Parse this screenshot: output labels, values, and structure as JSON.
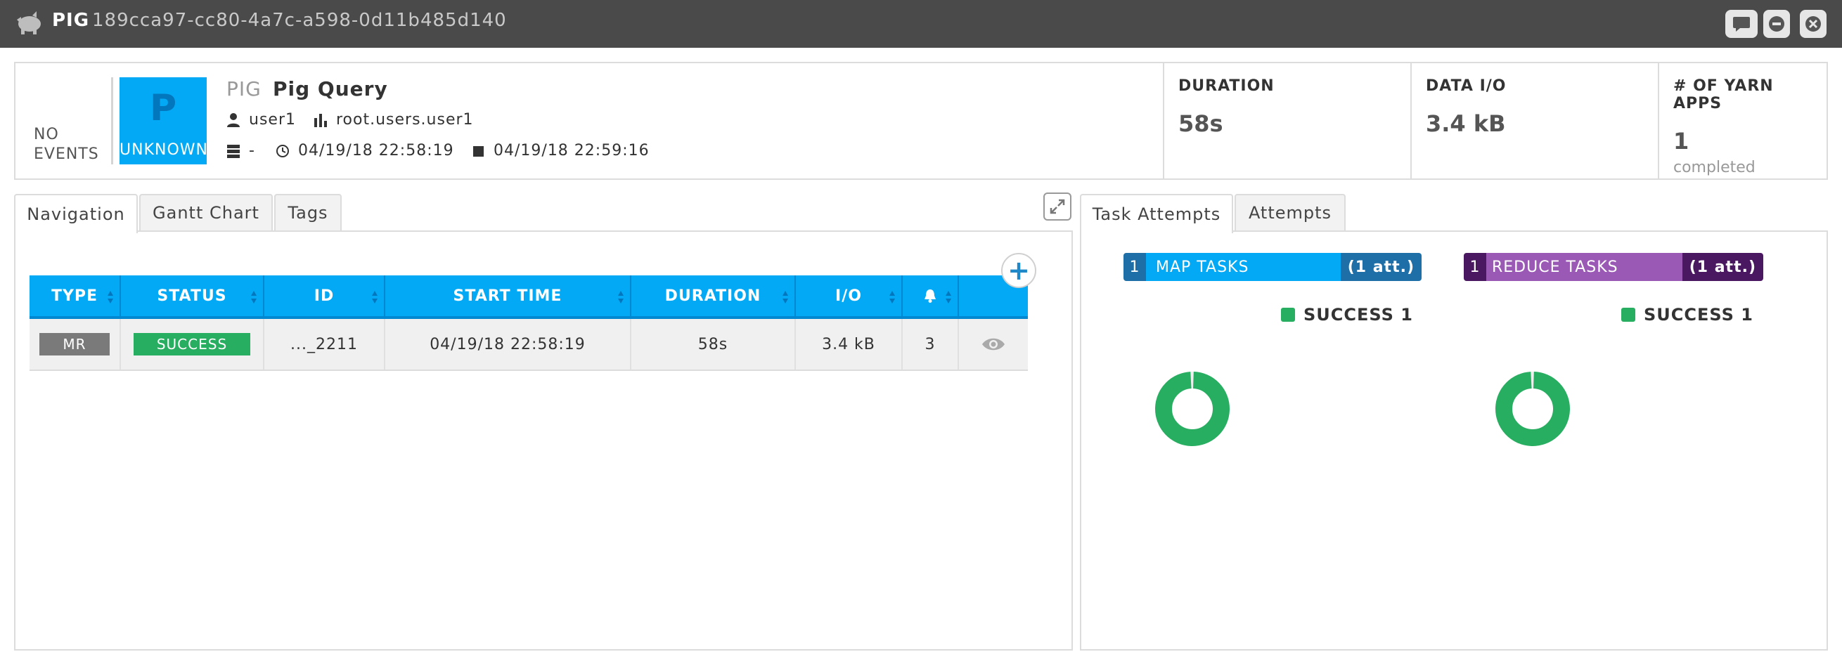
{
  "titlebar": {
    "type": "PIG",
    "id": "189cca97-cc80-4a7c-a598-0d11b485d140",
    "buttons": [
      "comment-icon",
      "minimize-icon",
      "close-icon"
    ]
  },
  "header": {
    "no_events_line1": "NO",
    "no_events_line2": "EVENTS",
    "status_letter": "P",
    "status_text": "UNKNOWN",
    "query_type": "PIG",
    "query_name": "Pig Query",
    "user": "user1",
    "queue": "root.users.user1",
    "cluster": "-",
    "start_time": "04/19/18 22:58:19",
    "end_time": "04/19/18 22:59:16",
    "stats": {
      "duration": {
        "label": "DURATION",
        "value": "58s"
      },
      "data_io": {
        "label": "DATA I/O",
        "value": "3.4 kB"
      },
      "yarn_apps": {
        "label": "# OF YARN APPS",
        "value": "1",
        "sub": "completed"
      }
    }
  },
  "left_tabs": [
    "Navigation",
    "Gantt Chart",
    "Tags"
  ],
  "right_tabs": [
    "Task Attempts",
    "Attempts"
  ],
  "table": {
    "columns": [
      "TYPE",
      "STATUS",
      "ID",
      "START TIME",
      "DURATION",
      "I/O"
    ],
    "rows": [
      {
        "type": "MR",
        "status": "SUCCESS",
        "id": "..._2211",
        "start_time": "04/19/18 22:58:19",
        "duration": "58s",
        "io": "3.4 kB",
        "alerts": "3"
      }
    ]
  },
  "tasks": {
    "map": {
      "count": "1",
      "label": "MAP TASKS",
      "attempts": "(1 att.)",
      "legend": "SUCCESS 1",
      "success": 1,
      "total": 1
    },
    "reduce": {
      "count": "1",
      "label": "REDUCE TASKS",
      "attempts": "(1 att.)",
      "legend": "SUCCESS 1",
      "success": 1,
      "total": 1
    }
  },
  "colors": {
    "accent": "#03a9f4",
    "success": "#27ae60",
    "map_dark": "#1e6fa8",
    "reduce": "#9b59b6",
    "reduce_dark": "#4a1860",
    "titlebar": "#4a4a4a"
  }
}
